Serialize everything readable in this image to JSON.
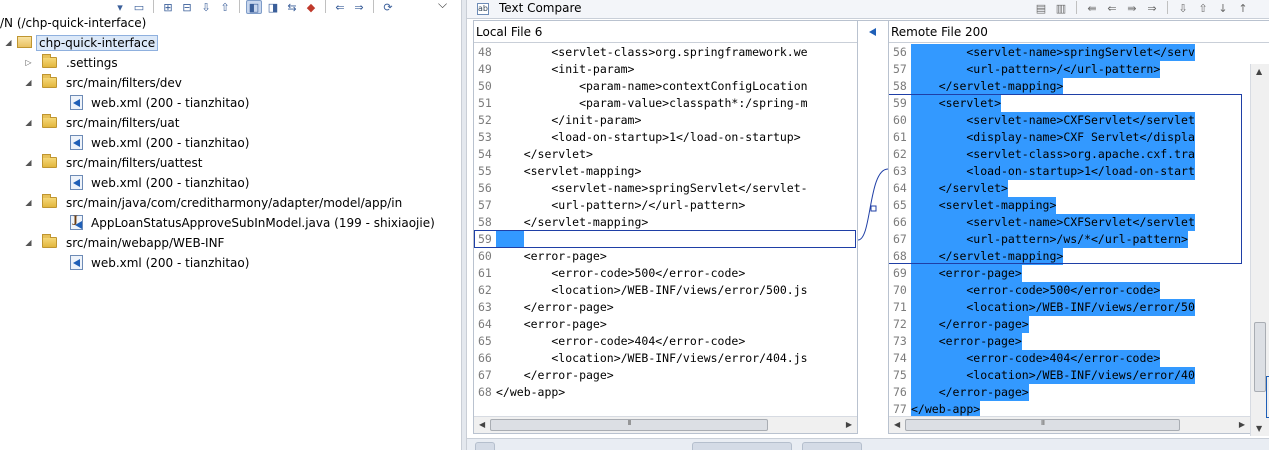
{
  "left": {
    "title": "/N (/chp-quick-interface)",
    "tree": [
      {
        "label": "chp-quick-interface",
        "depth": 0,
        "expanded": true,
        "type": "project",
        "selected": true
      },
      {
        "label": ".settings",
        "depth": 1,
        "expanded": false,
        "type": "folder"
      },
      {
        "label": "src/main/filters/dev",
        "depth": 1,
        "expanded": true,
        "type": "folder"
      },
      {
        "label": "web.xml (200 - tianzhitao)",
        "depth": 2,
        "type": "xml"
      },
      {
        "label": "src/main/filters/uat",
        "depth": 1,
        "expanded": true,
        "type": "folder"
      },
      {
        "label": "web.xml (200 - tianzhitao)",
        "depth": 2,
        "type": "xml"
      },
      {
        "label": "src/main/filters/uattest",
        "depth": 1,
        "expanded": true,
        "type": "folder"
      },
      {
        "label": "web.xml (200 - tianzhitao)",
        "depth": 2,
        "type": "xml"
      },
      {
        "label": "src/main/java/com/creditharmony/adapter/model/app/in",
        "depth": 1,
        "expanded": true,
        "type": "folder"
      },
      {
        "label": "AppLoanStatusApproveSubInModel.java (199 - shixiaojie)",
        "depth": 2,
        "type": "java"
      },
      {
        "label": "src/main/webapp/WEB-INF",
        "depth": 1,
        "expanded": true,
        "type": "folder"
      },
      {
        "label": "web.xml (200 - tianzhitao)",
        "depth": 2,
        "type": "xml"
      }
    ]
  },
  "compare": {
    "title": "Text Compare",
    "left_label": "Local File 6",
    "right_label": "Remote File 200",
    "left_lines": [
      {
        "n": "48",
        "text": "        <servlet-class>org.springframework.we"
      },
      {
        "n": "49",
        "text": "        <init-param>"
      },
      {
        "n": "50",
        "text": "            <param-name>contextConfigLocation"
      },
      {
        "n": "51",
        "text": "            <param-value>classpath*:/spring-m"
      },
      {
        "n": "52",
        "text": "        </init-param>"
      },
      {
        "n": "53",
        "text": "        <load-on-startup>1</load-on-startup>"
      },
      {
        "n": "54",
        "text": "    </servlet>"
      },
      {
        "n": "55",
        "text": "    <servlet-mapping>"
      },
      {
        "n": "56",
        "text": "        <servlet-name>springServlet</servlet-"
      },
      {
        "n": "57",
        "text": "        <url-pattern>/</url-pattern>"
      },
      {
        "n": "58",
        "text": "    </servlet-mapping>"
      },
      {
        "n": "59",
        "text": "    ",
        "hl": true
      },
      {
        "n": "60",
        "text": "    <error-page>"
      },
      {
        "n": "61",
        "text": "        <error-code>500</error-code>"
      },
      {
        "n": "62",
        "text": "        <location>/WEB-INF/views/error/500.js"
      },
      {
        "n": "63",
        "text": "    </error-page>"
      },
      {
        "n": "64",
        "text": "    <error-page>"
      },
      {
        "n": "65",
        "text": "        <error-code>404</error-code>"
      },
      {
        "n": "66",
        "text": "        <location>/WEB-INF/views/error/404.js"
      },
      {
        "n": "67",
        "text": "    </error-page>"
      },
      {
        "n": "68",
        "text": "</web-app>"
      }
    ],
    "right_lines": [
      {
        "n": "56",
        "text": "        <servlet-name>springServlet</serv",
        "hl": true
      },
      {
        "n": "57",
        "text": "        <url-pattern>/</url-pattern>",
        "hl": true
      },
      {
        "n": "58",
        "text": "    </servlet-mapping>",
        "hl": true
      },
      {
        "n": "59",
        "text": "    <servlet>",
        "hl": true
      },
      {
        "n": "60",
        "text": "        <servlet-name>CXFServlet</servlet",
        "hl": true
      },
      {
        "n": "61",
        "text": "        <display-name>CXF Servlet</displa",
        "hl": true
      },
      {
        "n": "62",
        "text": "        <servlet-class>org.apache.cxf.tra",
        "hl": true
      },
      {
        "n": "63",
        "text": "        <load-on-startup>1</load-on-start",
        "hl": true
      },
      {
        "n": "64",
        "text": "    </servlet>",
        "hl": true
      },
      {
        "n": "65",
        "text": "    <servlet-mapping>",
        "hl": true
      },
      {
        "n": "66",
        "text": "        <servlet-name>CXFServlet</servlet",
        "hl": true
      },
      {
        "n": "67",
        "text": "        <url-pattern>/ws/*</url-pattern>",
        "hl": true
      },
      {
        "n": "68",
        "text": "    </servlet-mapping>",
        "hl": true
      },
      {
        "n": "69",
        "text": "    <error-page>",
        "hl": true
      },
      {
        "n": "70",
        "text": "        <error-code>500</error-code>",
        "hl": true
      },
      {
        "n": "71",
        "text": "        <location>/WEB-INF/views/error/50",
        "hl": true
      },
      {
        "n": "72",
        "text": "    </error-page>",
        "hl": true
      },
      {
        "n": "73",
        "text": "    <error-page>",
        "hl": true
      },
      {
        "n": "74",
        "text": "        <error-code>404</error-code>",
        "hl": true
      },
      {
        "n": "75",
        "text": "        <location>/WEB-INF/views/error/40",
        "hl": true
      },
      {
        "n": "76",
        "text": "    </error-page>",
        "hl": true
      },
      {
        "n": "77",
        "text": "</web-app>",
        "hl": true
      }
    ]
  },
  "colors": {
    "selection": "#3399ff",
    "diff_box": "#1f3fa6",
    "tree_selected": "#dbe8f8"
  }
}
